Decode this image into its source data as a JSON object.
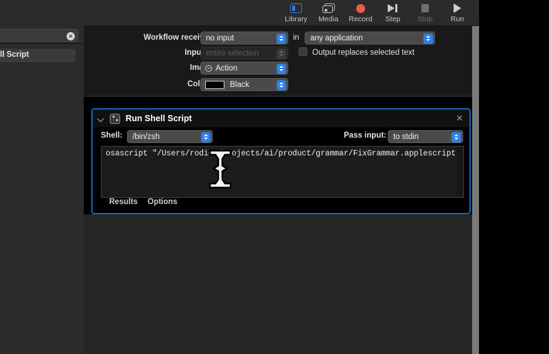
{
  "toolbar": {
    "items": [
      {
        "label": "Library",
        "icon": "library-icon",
        "enabled": true
      },
      {
        "label": "Media",
        "icon": "media-icon",
        "enabled": true
      },
      {
        "label": "Record",
        "icon": "record-icon",
        "enabled": true
      },
      {
        "label": "Step",
        "icon": "step-icon",
        "enabled": true
      },
      {
        "label": "Stop",
        "icon": "stop-icon",
        "enabled": false
      },
      {
        "label": "Run",
        "icon": "run-icon",
        "enabled": true
      }
    ]
  },
  "sidebar": {
    "search_value": "",
    "clear_icon": "clear-circle-icon",
    "visible_item_label": "ll Script"
  },
  "settings": {
    "workflow_receives_label": "Workflow receives",
    "workflow_receives_value": "no input",
    "in_label": "in",
    "application_value": "any application",
    "input_is_label": "Input is",
    "input_is_value": "entire selection",
    "output_replaces_label": "Output replaces selected text",
    "output_replaces_checked": false,
    "image_label": "Image",
    "image_value": "Action",
    "image_icon": "circle-minus-icon",
    "colour_label": "Colour",
    "colour_value": "Black",
    "colour_hex": "#000000"
  },
  "action": {
    "title": "Run Shell Script",
    "icon": "shell-script-icon",
    "disclosure_icon": "chevron-down-icon",
    "close_icon": "close-icon",
    "shell_label": "Shell:",
    "shell_value": "/bin/zsh",
    "pass_input_label": "Pass input:",
    "pass_input_value": "to stdin",
    "script": "osascript \"/Users/rodion/projects/ai/product/grammar/FixGrammar.applescript\"",
    "tabs": [
      "Results",
      "Options"
    ],
    "selection_color": "#1565c0"
  },
  "cursor": {
    "icon": "text-ibeam-cursor"
  }
}
